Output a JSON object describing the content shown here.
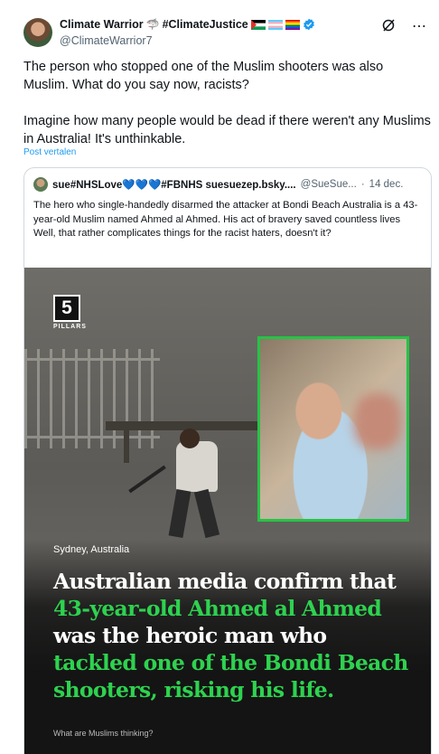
{
  "post": {
    "author_name": "Climate Warrior",
    "author_tag": "#ClimateJustice",
    "handle": "@ClimateWarrior7",
    "paragraph_1": "The person who stopped one of the Muslim shooters was also Muslim. What do you say now, racists?",
    "paragraph_2": "Imagine how many people would be dead if there weren't any Muslims in Australia! It's unthinkable.",
    "translate_label": "Post vertalen",
    "icons": [
      "grok-icon",
      "more-icon"
    ]
  },
  "quote": {
    "author_name": "sue#NHSLove💙💙💙#FBNHS suesuezep.bsky....",
    "handle": "@SueSue...",
    "separator": "·",
    "date": "14 dec.",
    "line_1": "The hero who single-handedly disarmed the attacker at Bondi Beach Australia is a 43-year-old Muslim named Ahmed al Ahmed. His act of bravery saved countless lives",
    "line_2": "Well, that rather complicates things for the racist haters, doesn't it?"
  },
  "media": {
    "logo_number": "5",
    "logo_text": "PILLARS",
    "location": "Sydney, Australia",
    "headline": {
      "l1": "Australian media confirm that",
      "l2": "43-year-old Ahmed al Ahmed",
      "l3": "was the heroic man who",
      "l4": "tackled one of the Bondi Beach",
      "l5": "shooters, risking his life."
    },
    "tagline": "What are Muslims thinking?",
    "colors": {
      "highlight": "#2ed24f",
      "inset_border": "#25c445"
    }
  }
}
